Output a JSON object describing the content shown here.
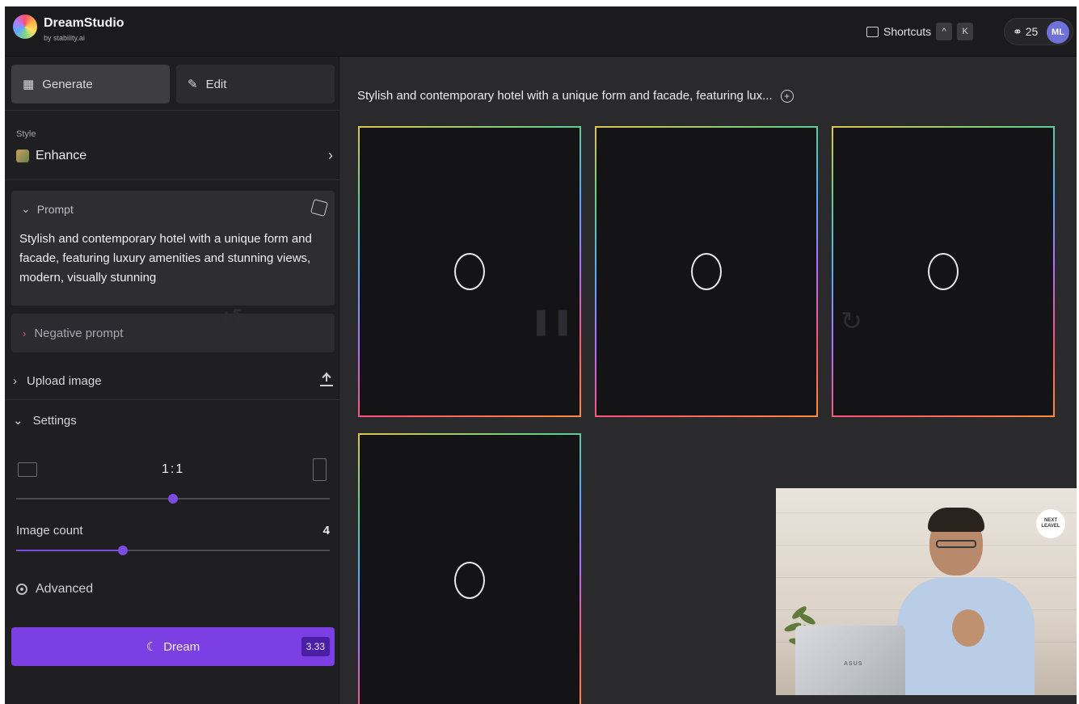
{
  "header": {
    "brand_name": "DreamStudio",
    "brand_sub": "by stability.ai",
    "shortcuts_label": "Shortcuts",
    "shortcut_keys": [
      "^",
      "K"
    ],
    "credits": "25",
    "avatar_initials": "ML"
  },
  "sidebar": {
    "tabs": [
      {
        "label": "Generate",
        "active": true
      },
      {
        "label": "Edit",
        "active": false
      }
    ],
    "style": {
      "label": "Style",
      "value": "Enhance"
    },
    "prompt": {
      "label": "Prompt",
      "text": "Stylish and contemporary hotel with a unique form and facade, featuring luxury amenities and stunning views, modern, visually stunning"
    },
    "negative_prompt_label": "Negative prompt",
    "upload_label": "Upload image",
    "settings_label": "Settings",
    "aspect_ratio": {
      "value": "1:1",
      "position": 0.5
    },
    "image_count": {
      "label": "Image count",
      "value": "4",
      "position": 0.34
    },
    "advanced_label": "Advanced",
    "dream": {
      "label": "Dream",
      "cost": "3.33"
    }
  },
  "main": {
    "title": "Stylish and contemporary hotel with a unique form and facade, featuring lux...",
    "tiles": [
      {
        "status": "loading"
      },
      {
        "status": "loading"
      },
      {
        "status": "loading"
      },
      {
        "status": "loading"
      }
    ]
  },
  "webcam": {
    "logo_text": "NEXT LEAVEL"
  },
  "colors": {
    "accent": "#7b3fe4",
    "background": "#2a2a2d",
    "sidebar": "#1f1f22"
  }
}
